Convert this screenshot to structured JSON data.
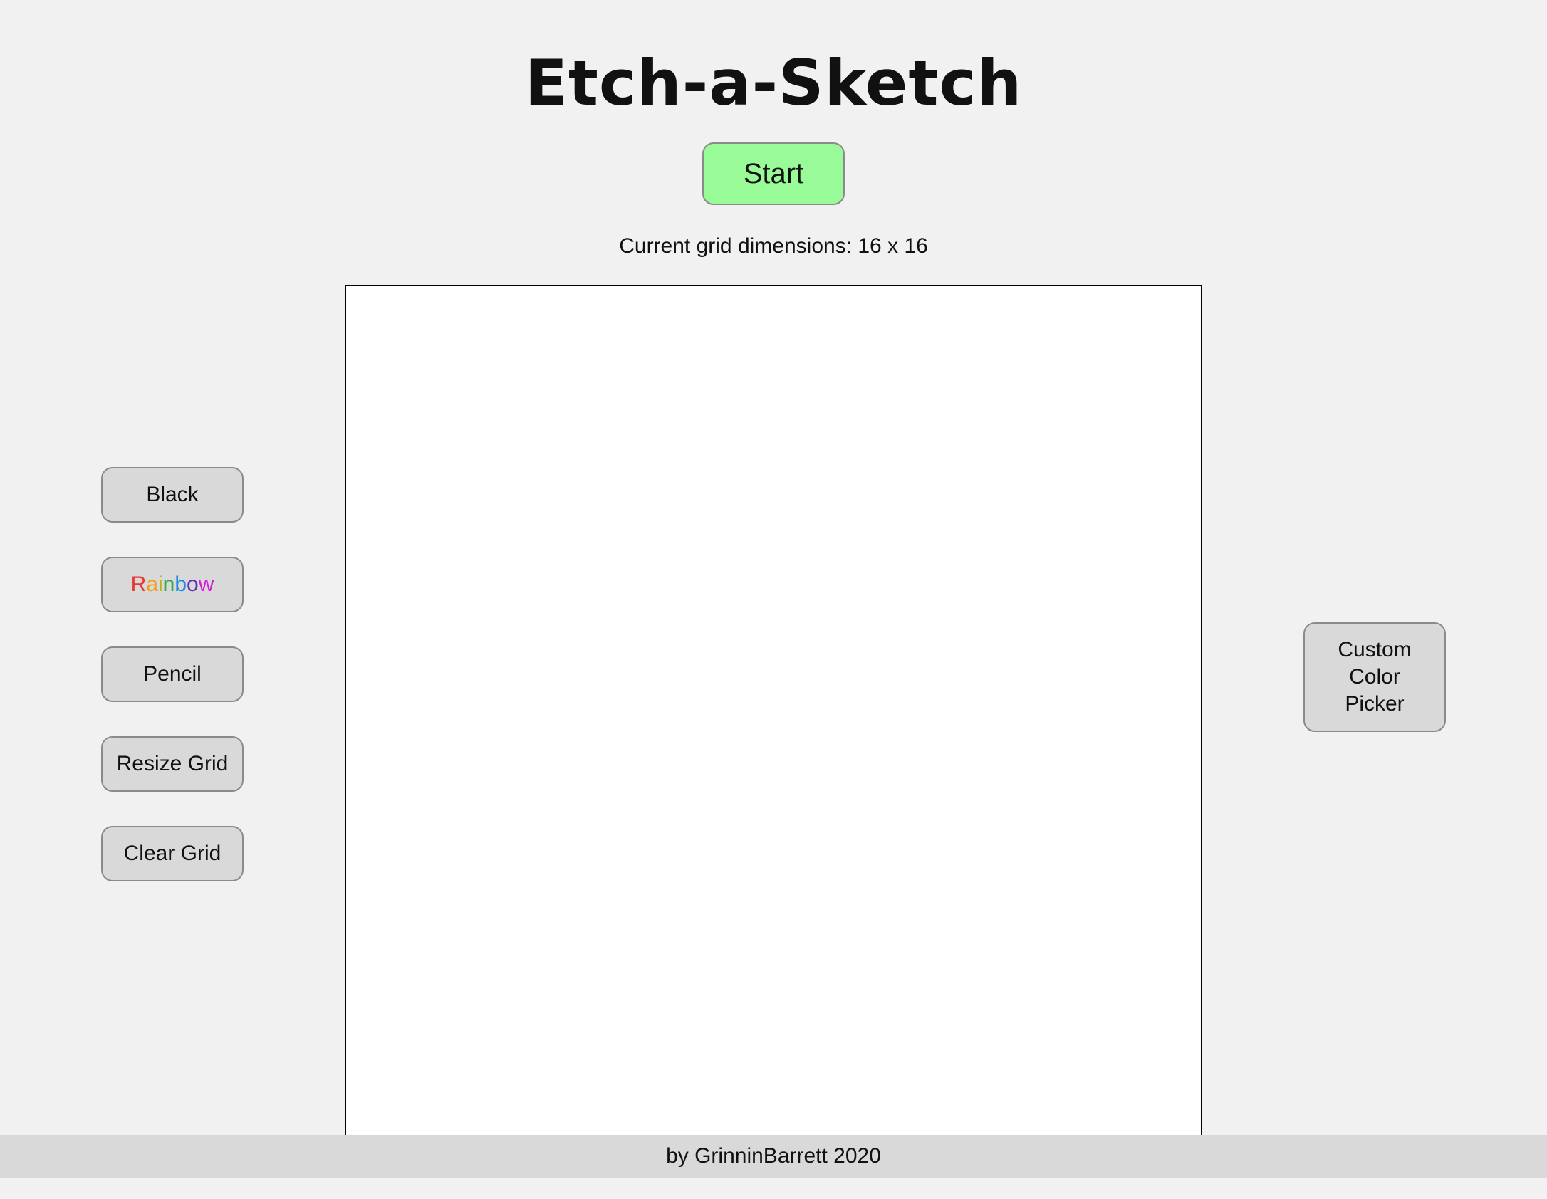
{
  "header": {
    "title": "Etch-a-Sketch",
    "start_label": "Start",
    "grid_dimensions_text": "Current grid dimensions: 16 x 16"
  },
  "left_controls": {
    "black_label": "Black",
    "rainbow_label": "Rainbow",
    "pencil_label": "Pencil",
    "resize_label": "Resize Grid",
    "clear_label": "Clear Grid"
  },
  "right_controls": {
    "custom_color_label": "Custom Color Picker"
  },
  "footer": {
    "credit": "by GrinninBarrett 2020"
  },
  "colors": {
    "background": "#f1f1f1",
    "start_button": "#98fb98",
    "button": "#d9d9d9",
    "grid": "#ffffff",
    "rainbow_letters": [
      "#e53935",
      "#f39c12",
      "#c0b000",
      "#2eaa4a",
      "#1e88e5",
      "#5e35b1",
      "#d81bd8"
    ]
  }
}
